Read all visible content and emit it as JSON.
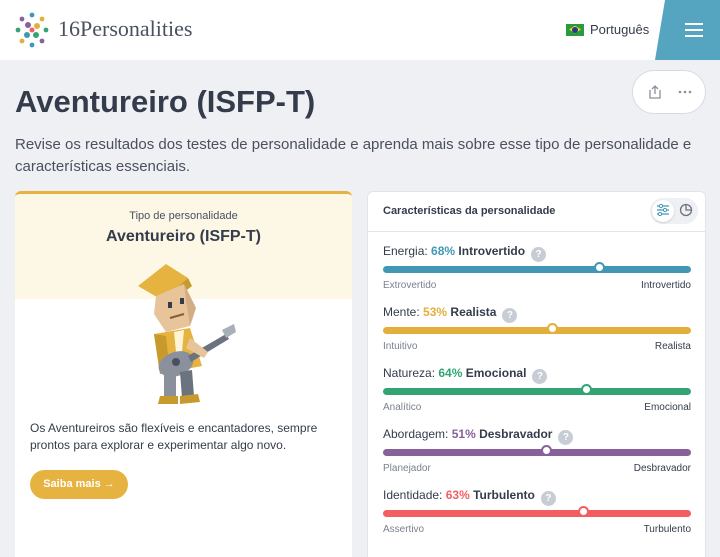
{
  "brand": {
    "name": "16Personalities"
  },
  "language": {
    "label": "Português"
  },
  "page": {
    "title": "Aventureiro (ISFP-T)",
    "subtitle": "Revise os resultados dos testes de personalidade e aprenda mais sobre esse tipo de personalidade e características essenciais."
  },
  "left_card": {
    "type_label": "Tipo de personalidade",
    "type_name": "Aventureiro (ISFP-T)",
    "description": "Os Aventureiros são flexíveis e encantadores, sempre prontos para explorar e experimentar algo novo.",
    "cta_label": "Saiba mais →"
  },
  "right_card": {
    "title": "Características da personalidade",
    "traits": [
      {
        "label": "Energia:",
        "pct": "68%",
        "side": "Introvertido",
        "left": "Extrovertido",
        "right": "Introvertido",
        "value": 0.7,
        "color": "#4298b4"
      },
      {
        "label": "Mente:",
        "pct": "53%",
        "side": "Realista",
        "left": "Intuitivo",
        "right": "Realista",
        "value": 0.55,
        "color": "#e4ae3a"
      },
      {
        "label": "Natureza:",
        "pct": "64%",
        "side": "Emocional",
        "left": "Analítico",
        "right": "Emocional",
        "value": 0.66,
        "color": "#33a474"
      },
      {
        "label": "Abordagem:",
        "pct": "51%",
        "side": "Desbravador",
        "left": "Planejador",
        "right": "Desbravador",
        "value": 0.53,
        "color": "#88619a"
      },
      {
        "label": "Identidade:",
        "pct": "63%",
        "side": "Turbulento",
        "left": "Assertivo",
        "right": "Turbulento",
        "value": 0.65,
        "color": "#f25e62"
      }
    ]
  },
  "icons": {
    "menu": "hamburger-menu-icon",
    "share": "share-icon",
    "more": "more-dots-icon",
    "sliders": "sliders-icon",
    "pie": "pie-chart-icon",
    "help": "question-icon"
  },
  "colors": {
    "accent": "#e6b341",
    "menu": "#56a5c0"
  }
}
